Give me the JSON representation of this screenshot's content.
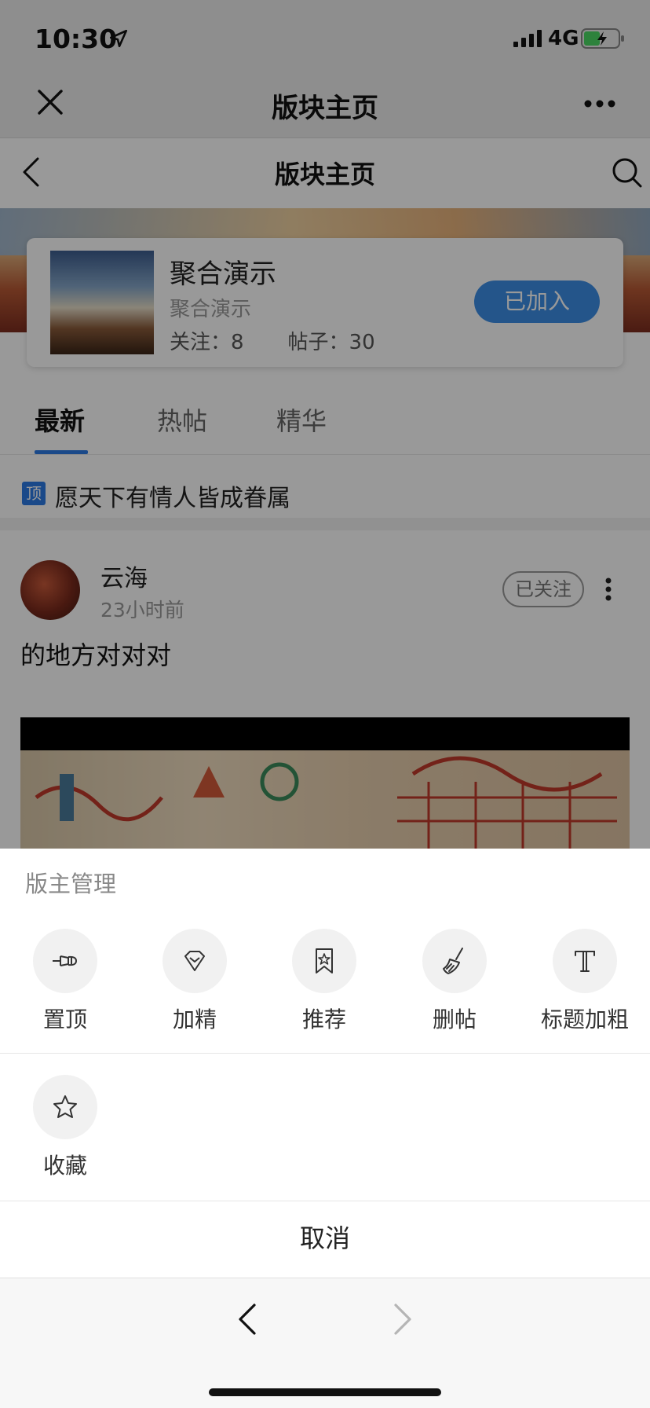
{
  "status_bar": {
    "time": "10:30",
    "network": "4G"
  },
  "wechat_header": {
    "title": "版块主页"
  },
  "page": {
    "nav_title": "版块主页",
    "forum": {
      "name": "聚合演示",
      "subtitle": "聚合演示",
      "followers": "关注：8",
      "posts": "帖子：30",
      "join_label": "已加入"
    },
    "tabs": [
      {
        "label": "最新",
        "active": true
      },
      {
        "label": "热帖",
        "active": false
      },
      {
        "label": "精华",
        "active": false
      }
    ],
    "pinned": {
      "badge": "顶",
      "title": "愿天下有情人皆成眷属"
    },
    "post": {
      "author": "云海",
      "time": "23小时前",
      "follow_label": "已关注",
      "text": "的地方对对对"
    }
  },
  "sheet": {
    "title": "版主管理",
    "actions": [
      {
        "label": "置顶",
        "icon": "pin-icon"
      },
      {
        "label": "加精",
        "icon": "diamond-icon"
      },
      {
        "label": "推荐",
        "icon": "bookmark-star-icon"
      },
      {
        "label": "删帖",
        "icon": "broom-icon"
      },
      {
        "label": "标题加粗",
        "icon": "bold-t-icon"
      },
      {
        "label": "收藏",
        "icon": "star-icon"
      }
    ],
    "cancel_label": "取消"
  },
  "colors": {
    "accent": "#2c7be5",
    "join_button": "#3d8ee6"
  }
}
